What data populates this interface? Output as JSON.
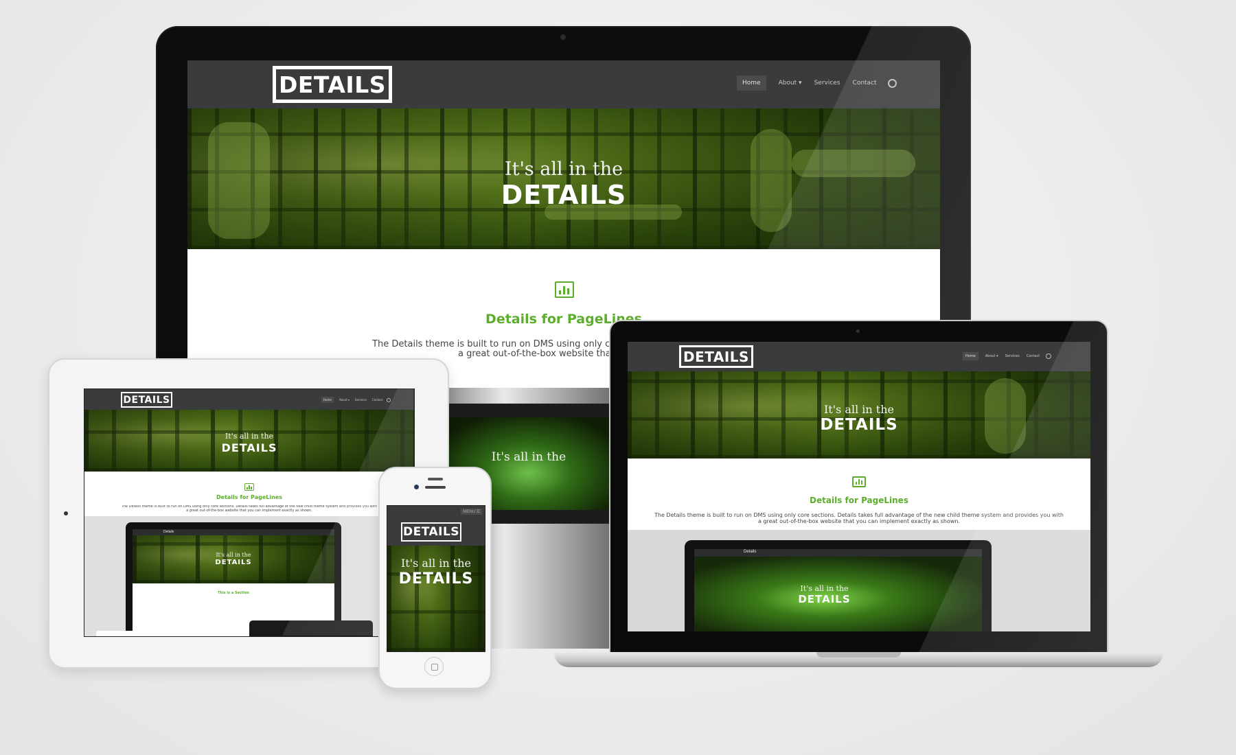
{
  "brand": {
    "logo_text": "DETAILS",
    "accent_color": "#5cad2c"
  },
  "nav": {
    "items": [
      "Home",
      "About ▾",
      "Services",
      "Contact"
    ],
    "menu_label": "MENU ☰"
  },
  "hero": {
    "line1": "It's all in the",
    "line2": "DETAILS"
  },
  "feature": {
    "icon": "bar-chart-icon",
    "title": "Details for PageLines",
    "text_line1": "The Details theme is built to run on DMS using only core sections. Details takes full advantage of the new child theme system and provides you with",
    "text_line2": "a great out-of-the-box website that you can implement exactly as shown.",
    "desktop_text_line1": "The Details theme is built to run on DMS using only core sections. Details takes full ad",
    "desktop_text_line2": "a great out-of-the-box website that you can imp"
  },
  "nested": {
    "brand": "Details",
    "section_title": "This is a Section"
  },
  "devices": {
    "desktop": "imac",
    "laptop": "macbook",
    "tablet": "ipad",
    "phone": "iphone"
  }
}
